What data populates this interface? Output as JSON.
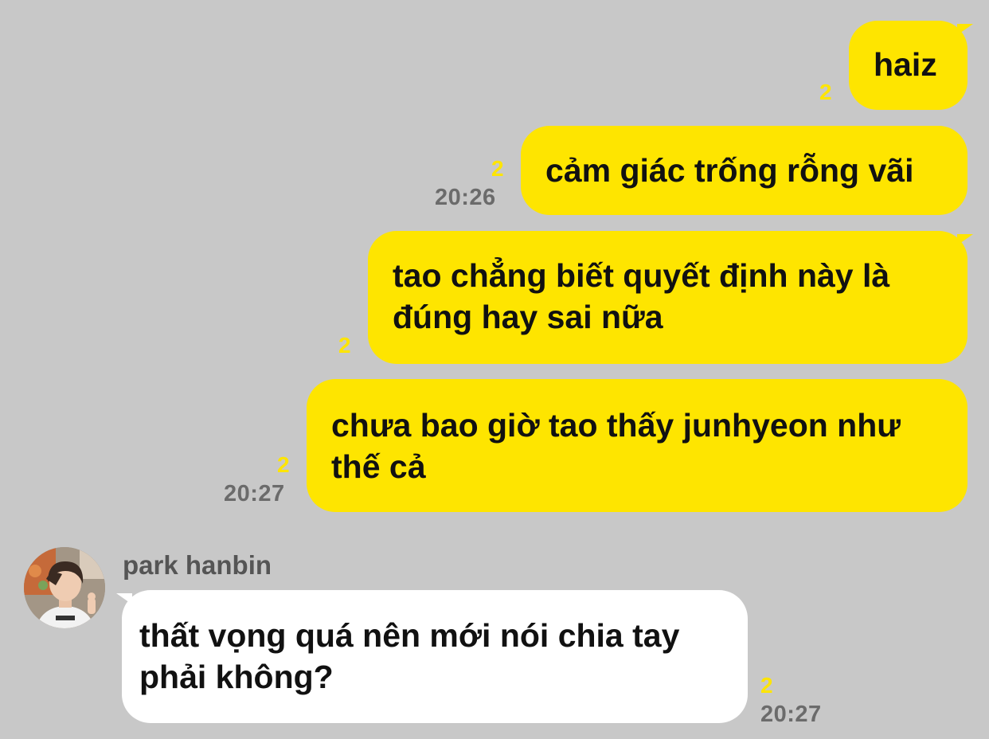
{
  "colors": {
    "background": "#c8c8c8",
    "outgoing_bubble": "#fee500",
    "incoming_bubble": "#ffffff",
    "unread_count": "#fee500",
    "timestamp": "#6b6b6b",
    "sender_name": "#555555"
  },
  "messages": [
    {
      "direction": "outgoing",
      "lines": [
        "haiz"
      ],
      "unread": "2",
      "time": ""
    },
    {
      "direction": "outgoing",
      "lines": [
        "cảm giác trống rỗng vãi"
      ],
      "unread": "2",
      "time": "20:26"
    },
    {
      "direction": "outgoing",
      "lines": [
        "tao chẳng biết quyết định này là",
        "đúng hay sai nữa"
      ],
      "unread": "2",
      "time": ""
    },
    {
      "direction": "outgoing",
      "lines": [
        "chưa bao giờ tao thấy junhyeon như",
        "thế cả"
      ],
      "unread": "2",
      "time": "20:27"
    },
    {
      "direction": "incoming",
      "sender": "park hanbin",
      "avatar": "profile-photo",
      "lines": [
        "thất vọng quá nên mới nói chia tay",
        "phải không?"
      ],
      "unread": "2",
      "time": "20:27"
    }
  ]
}
